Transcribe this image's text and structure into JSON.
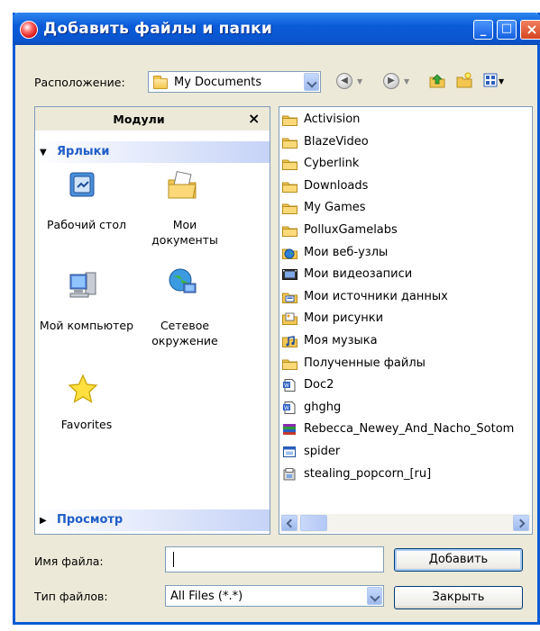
{
  "window": {
    "title": "Добавить файлы и папки",
    "controls": {
      "minimize": "_",
      "maximize": "□",
      "close": "×"
    }
  },
  "location": {
    "label": "Расположение:",
    "value": "My Documents"
  },
  "modules": {
    "title": "Модули",
    "close": "×",
    "shortcuts_section": "Ярлыки",
    "preview_section": "Просмотр",
    "shortcuts": [
      {
        "label": "Рабочий стол",
        "icon": "desktop-icon"
      },
      {
        "label": "Мои документы",
        "icon": "my-documents-icon"
      },
      {
        "label": "Мой компьютер",
        "icon": "my-computer-icon"
      },
      {
        "label": "Сетевое окружение",
        "icon": "network-icon"
      },
      {
        "label": "Favorites",
        "icon": "star-icon"
      }
    ]
  },
  "files": [
    {
      "name": "Activision",
      "icon": "folder"
    },
    {
      "name": "BlazeVideo",
      "icon": "folder"
    },
    {
      "name": "Cyberlink",
      "icon": "folder"
    },
    {
      "name": "Downloads",
      "icon": "folder"
    },
    {
      "name": "My Games",
      "icon": "folder"
    },
    {
      "name": "PolluxGamelabs",
      "icon": "folder"
    },
    {
      "name": "Мои веб-узлы",
      "icon": "web-folder"
    },
    {
      "name": "Мои видеозаписи",
      "icon": "video-folder"
    },
    {
      "name": "Мои источники данных",
      "icon": "data-folder"
    },
    {
      "name": "Мои рисунки",
      "icon": "pictures-folder"
    },
    {
      "name": "Моя музыка",
      "icon": "music-folder"
    },
    {
      "name": "Полученные файлы",
      "icon": "folder"
    },
    {
      "name": "Doc2",
      "icon": "word-doc"
    },
    {
      "name": "ghghg",
      "icon": "word-doc"
    },
    {
      "name": "Rebecca_Newey_And_Nacho_Sotom",
      "icon": "archive"
    },
    {
      "name": "spider",
      "icon": "exe"
    },
    {
      "name": "stealing_popcorn_[ru]",
      "icon": "installer"
    }
  ],
  "filename": {
    "label": "Имя файла:",
    "value": ""
  },
  "filetype": {
    "label": "Тип файлов:",
    "value": "All Files (*.*)"
  },
  "buttons": {
    "add": "Добавить",
    "close": "Закрыть"
  },
  "colors": {
    "titlebar": "#0A5BD6",
    "section_text": "#215DC6",
    "dialog_bg": "#ECE9D8"
  }
}
